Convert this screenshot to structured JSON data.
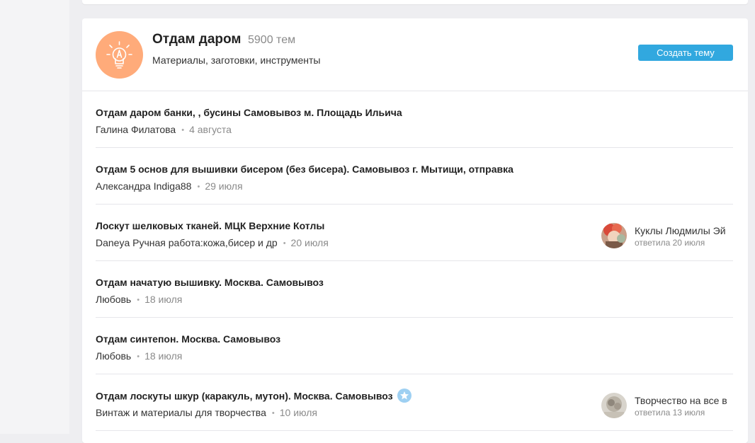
{
  "group": {
    "title": "Отдам даром",
    "topic_count": "5900 тем",
    "subtitle": "Материалы, заготовки, инструменты",
    "icon": "lightbulb-pencil-icon",
    "avatar_color": "#ffab7a"
  },
  "actions": {
    "create_topic": "Создать тему",
    "accent": "#31a8df"
  },
  "topics": [
    {
      "title": "Отдам даром банки, , бусины Самовывоз м. Площадь Ильича",
      "author": "Галина Филатова",
      "date": "4 августа"
    },
    {
      "title": "Отдам 5 основ для вышивки бисером (без бисера). Самовывоз г. Мытищи, отправка",
      "author": "Александра Indiga88",
      "date": "29 июля"
    },
    {
      "title": "Лоскут шелковых тканей. МЦК Верхние Котлы",
      "author": "Daneya Ручная работа:кожа,бисер и др",
      "date": "20 июля",
      "last_reply": {
        "name": "Куклы Людмилы Эй",
        "date": "ответила 20 июля"
      }
    },
    {
      "title": "Отдам начатую вышивку. Москва. Самовывоз",
      "author": "Любовь",
      "date": "18 июля"
    },
    {
      "title": "Отдам синтепон. Москва. Самовывоз",
      "author": "Любовь",
      "date": "18 июля"
    },
    {
      "title": "Отдам лоскуты шкур (каракуль, мутон). Москва. Самовывоз",
      "author": "Винтаж и материалы для творчества",
      "date": "10 июля",
      "badge": "star-icon",
      "last_reply": {
        "name": "Творчество на все в",
        "date": "ответила 13 июля"
      }
    }
  ]
}
